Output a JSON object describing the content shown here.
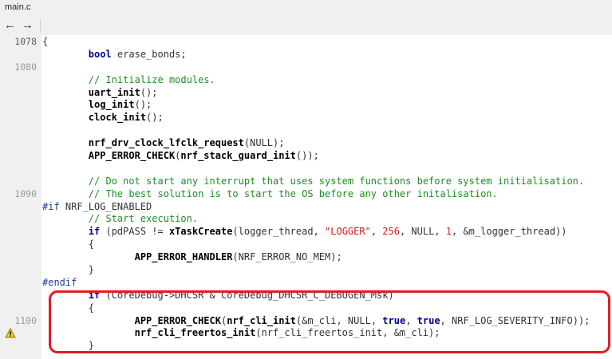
{
  "tab": {
    "title": "main.c"
  },
  "nav": {
    "back_icon": "←",
    "forward_icon": "→"
  },
  "highlight": {
    "color": "#e31b23"
  },
  "lines": [
    {
      "num": "1078",
      "current": true,
      "tokens": [
        [
          "p",
          "{"
        ]
      ]
    },
    {
      "num": "",
      "tokens": [
        [
          "p",
          "        "
        ],
        [
          "kw",
          "bool"
        ],
        [
          "p",
          " erase_bonds;"
        ]
      ]
    },
    {
      "num": "1080",
      "tokens": []
    },
    {
      "num": "",
      "tokens": [
        [
          "p",
          "        "
        ],
        [
          "cm",
          "// Initialize modules."
        ]
      ]
    },
    {
      "num": "",
      "tokens": [
        [
          "p",
          "        "
        ],
        [
          "fn",
          "uart_init"
        ],
        [
          "p",
          "();"
        ]
      ]
    },
    {
      "num": "",
      "tokens": [
        [
          "p",
          "        "
        ],
        [
          "fn",
          "log_init"
        ],
        [
          "p",
          "();"
        ]
      ]
    },
    {
      "num": "",
      "tokens": [
        [
          "p",
          "        "
        ],
        [
          "fn",
          "clock_init"
        ],
        [
          "p",
          "();"
        ]
      ]
    },
    {
      "num": "",
      "tokens": []
    },
    {
      "num": "",
      "tokens": [
        [
          "p",
          "        "
        ],
        [
          "fn",
          "nrf_drv_clock_lfclk_request"
        ],
        [
          "p",
          "(NULL);"
        ]
      ]
    },
    {
      "num": "",
      "tokens": [
        [
          "p",
          "        "
        ],
        [
          "fn",
          "APP_ERROR_CHECK"
        ],
        [
          "p",
          "("
        ],
        [
          "fn",
          "nrf_stack_guard_init"
        ],
        [
          "p",
          "());"
        ]
      ]
    },
    {
      "num": "",
      "tokens": []
    },
    {
      "num": "",
      "tokens": [
        [
          "p",
          "        "
        ],
        [
          "cm",
          "// Do not start any interrupt that uses system functions before system initialisation."
        ]
      ]
    },
    {
      "num": "1090",
      "tokens": [
        [
          "p",
          "        "
        ],
        [
          "cm",
          "// The best solution is to start the OS before any other initalisation."
        ]
      ]
    },
    {
      "num": "",
      "tokens": [
        [
          "pp",
          "#if"
        ],
        [
          "p",
          " NRF_LOG_ENABLED"
        ]
      ]
    },
    {
      "num": "",
      "tokens": [
        [
          "p",
          "        "
        ],
        [
          "cm",
          "// Start execution."
        ]
      ]
    },
    {
      "num": "",
      "tokens": [
        [
          "p",
          "        "
        ],
        [
          "kw",
          "if"
        ],
        [
          "p",
          " (pdPASS != "
        ],
        [
          "fn",
          "xTaskCreate"
        ],
        [
          "p",
          "(logger_thread, "
        ],
        [
          "str",
          "\"LOGGER\""
        ],
        [
          "p",
          ", "
        ],
        [
          "numlit",
          "256"
        ],
        [
          "p",
          ", NULL, "
        ],
        [
          "numlit",
          "1"
        ],
        [
          "p",
          ", &m_logger_thread))"
        ]
      ]
    },
    {
      "num": "",
      "tokens": [
        [
          "p",
          "        {"
        ]
      ]
    },
    {
      "num": "",
      "tokens": [
        [
          "p",
          "                "
        ],
        [
          "fn",
          "APP_ERROR_HANDLER"
        ],
        [
          "p",
          "(NRF_ERROR_NO_MEM);"
        ]
      ]
    },
    {
      "num": "",
      "tokens": [
        [
          "p",
          "        }"
        ]
      ]
    },
    {
      "num": "",
      "tokens": [
        [
          "pp",
          "#endif"
        ]
      ]
    },
    {
      "num": "",
      "tokens": [
        [
          "p",
          "        "
        ],
        [
          "kw",
          "if"
        ],
        [
          "p",
          " (CoreDebug->DHCSR & CoreDebug_DHCSR_C_DEBUGEN_Msk)"
        ]
      ]
    },
    {
      "num": "",
      "tokens": [
        [
          "p",
          "        {"
        ]
      ]
    },
    {
      "num": "1100",
      "tokens": [
        [
          "p",
          "                "
        ],
        [
          "fn",
          "APP_ERROR_CHECK"
        ],
        [
          "p",
          "("
        ],
        [
          "fn",
          "nrf_cli_init"
        ],
        [
          "p",
          "(&m_cli, NULL, "
        ],
        [
          "kw",
          "true"
        ],
        [
          "p",
          ", "
        ],
        [
          "kw",
          "true"
        ],
        [
          "p",
          ", NRF_LOG_SEVERITY_INFO));"
        ]
      ]
    },
    {
      "num": "",
      "warning": true,
      "tokens": [
        [
          "p",
          "                "
        ],
        [
          "fn",
          "nrf_cli_freertos_init"
        ],
        [
          "p",
          "(nrf_cli_freertos_init, &m_cli);"
        ]
      ]
    },
    {
      "num": "",
      "tokens": [
        [
          "p",
          "        }"
        ]
      ]
    }
  ]
}
